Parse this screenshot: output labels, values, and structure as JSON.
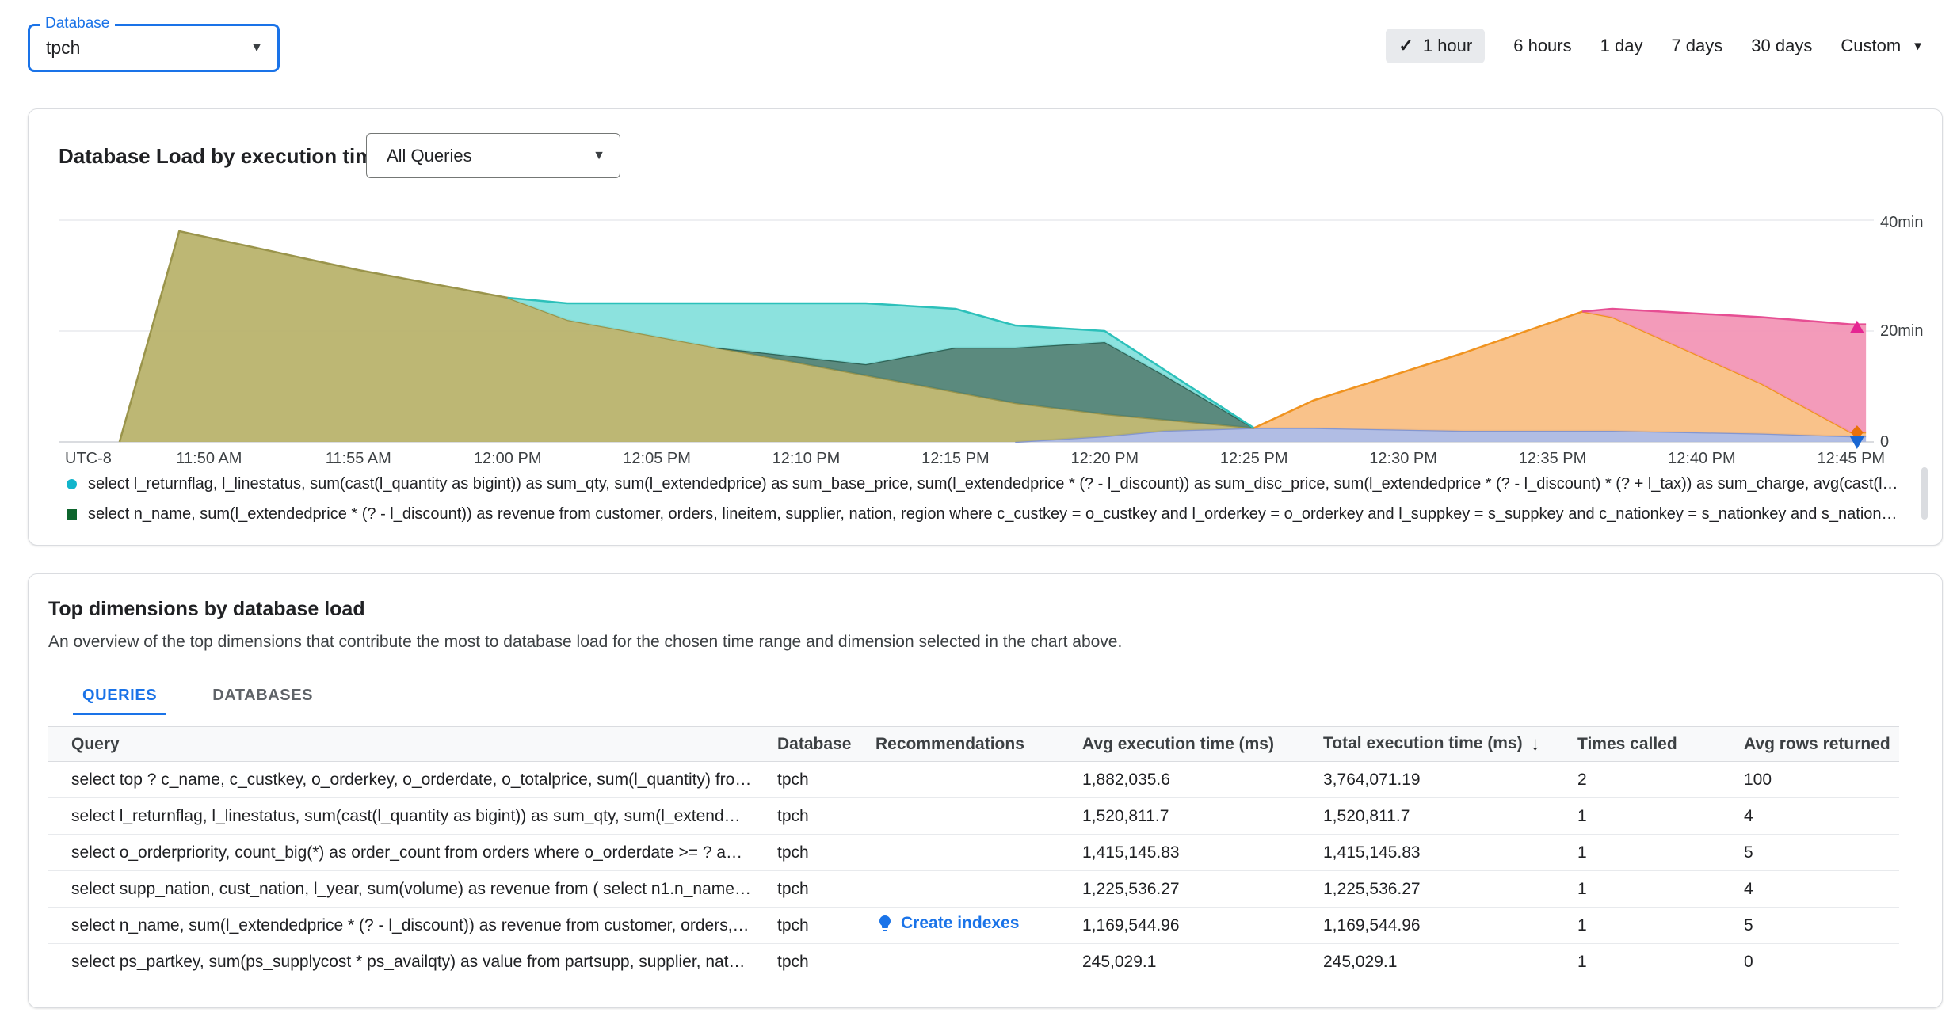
{
  "icons": {
    "check": "✓",
    "caret_down": "▼",
    "sort_desc": "↓"
  },
  "header": {
    "database_selector": {
      "label": "Database",
      "value": "tpch"
    },
    "time_range": {
      "options": [
        {
          "label": "1 hour",
          "selected": true,
          "has_caret": false
        },
        {
          "label": "6 hours",
          "selected": false,
          "has_caret": false
        },
        {
          "label": "1 day",
          "selected": false,
          "has_caret": false
        },
        {
          "label": "7 days",
          "selected": false,
          "has_caret": false
        },
        {
          "label": "30 days",
          "selected": false,
          "has_caret": false
        },
        {
          "label": "Custom",
          "selected": false,
          "has_caret": true
        }
      ]
    }
  },
  "load_card": {
    "title": "Database Load by execution time",
    "query_filter": {
      "value": "All Queries"
    },
    "chart_data": {
      "type": "area",
      "stacked": true,
      "title": "Database Load by execution time",
      "x_axis": {
        "prefix_label": "UTC-8",
        "ticks": [
          "11:50 AM",
          "11:55 AM",
          "12:00 PM",
          "12:05 PM",
          "12:10 PM",
          "12:15 PM",
          "12:20 PM",
          "12:25 PM",
          "12:30 PM",
          "12:35 PM",
          "12:40 PM",
          "12:45 PM"
        ],
        "tick_minutes": [
          5,
          10,
          15,
          20,
          25,
          30,
          35,
          40,
          45,
          50,
          55,
          60
        ]
      },
      "y_axis": {
        "unit": "min",
        "max": 40,
        "tick_labels": [
          "40min",
          "20min",
          "0"
        ],
        "tick_values": [
          40,
          20,
          0
        ]
      },
      "time_grid_minutes": [
        0,
        2,
        4,
        10,
        15,
        17,
        22,
        27,
        30,
        32,
        35,
        37,
        40,
        42,
        47,
        51,
        52,
        57,
        60,
        60.5
      ],
      "series": [
        {
          "id": "series-periwinkle",
          "fill": "#aab7e2",
          "stroke": "#8496cf",
          "values": [
            0,
            0,
            0,
            0,
            0,
            0,
            0,
            0,
            0,
            0,
            1,
            2,
            2.5,
            2.5,
            2,
            2,
            2,
            1.5,
            1,
            1
          ]
        },
        {
          "id": "series-olive",
          "fill": "#b7b168",
          "stroke": "#9a944b",
          "values": [
            0,
            0,
            38,
            31,
            26,
            22,
            17,
            12,
            9,
            7,
            4,
            2,
            0,
            0,
            0,
            0,
            0,
            0,
            0,
            0
          ]
        },
        {
          "id": "series-darkgreen",
          "fill": "#4d8073",
          "stroke": "#2f6457",
          "values": [
            0,
            0,
            0,
            0,
            0,
            0,
            0,
            2,
            8,
            10,
            13,
            8,
            0,
            0,
            0,
            0,
            0,
            0,
            0,
            0
          ]
        },
        {
          "id": "series-cyan",
          "fill": "#82dfdb",
          "stroke": "#2cc0ba",
          "values": [
            0,
            0,
            0,
            0,
            0,
            3,
            8,
            11,
            7,
            4,
            2,
            1,
            0,
            0,
            0,
            0,
            0,
            0,
            0,
            0
          ]
        },
        {
          "id": "series-orange",
          "fill": "#f9bd80",
          "stroke": "#f0931f",
          "values": [
            0,
            0,
            0,
            0,
            0,
            0,
            0,
            0,
            0,
            0,
            0,
            0,
            0,
            5,
            14,
            21.5,
            20.5,
            9,
            0.7,
            0.7
          ]
        },
        {
          "id": "series-pink",
          "fill": "#f292b4",
          "stroke": "#e64e93",
          "values": [
            0,
            0,
            0,
            0,
            0,
            0,
            0,
            0,
            0,
            0,
            0,
            0,
            0,
            0,
            0,
            0,
            1.5,
            12,
            19.5,
            19.5
          ]
        }
      ],
      "markers": [
        {
          "shape": "triangle-up",
          "color": "#e52592",
          "t": 60.2,
          "value": 20.6
        },
        {
          "shape": "diamond",
          "color": "#e8710a",
          "t": 60.2,
          "value": 1.7
        },
        {
          "shape": "triangle-down",
          "color": "#1967d2",
          "t": 60.2,
          "value": 0
        }
      ]
    },
    "legend": [
      {
        "marker": "circle",
        "color": "#12b5cb",
        "text": "select l_returnflag, l_linestatus, sum(cast(l_quantity as bigint)) as sum_qty, sum(l_extendedprice) as sum_base_price, sum(l_extendedprice * (? - l_discount)) as sum_disc_price, sum(l_extendedprice * (? - l_discount) * (? + l_tax)) as sum_charge, avg(cast(l_quantity as …"
      },
      {
        "marker": "square",
        "color": "#0d652d",
        "text": "select n_name, sum(l_extendedprice * (? - l_discount)) as revenue from customer, orders, lineitem, supplier, nation, region where c_custkey = o_custkey and l_orderkey = o_orderkey and l_suppkey = s_suppkey and c_nationkey = s_nationkey and s_nationkey = n_nation…"
      }
    ]
  },
  "dimensions_card": {
    "title": "Top dimensions by database load",
    "subtitle": "An overview of the top dimensions that contribute the most to database load for the chosen time range and dimension selected in the chart above.",
    "tabs": [
      {
        "label": "QUERIES",
        "active": true
      },
      {
        "label": "DATABASES",
        "active": false
      }
    ],
    "table": {
      "columns": [
        {
          "label": "Query"
        },
        {
          "label": "Database"
        },
        {
          "label": "Recommendations"
        },
        {
          "label": "Avg execution time (ms)"
        },
        {
          "label": "Total execution time (ms)",
          "sort": "desc"
        },
        {
          "label": "Times called"
        },
        {
          "label": "Avg rows returned"
        }
      ],
      "rows": [
        {
          "query": "select top ? c_name, c_custkey, o_orderkey, o_orderdate, o_totalprice, sum(l_quantity) fro…",
          "database": "tpch",
          "recommendation": "",
          "avg_execution_time_ms": "1,882,035.6",
          "total_execution_time_ms": "3,764,071.19",
          "times_called": "2",
          "avg_rows_returned": "100"
        },
        {
          "query": "select l_returnflag, l_linestatus, sum(cast(l_quantity as bigint)) as sum_qty, sum(l_extend…",
          "database": "tpch",
          "recommendation": "",
          "avg_execution_time_ms": "1,520,811.7",
          "total_execution_time_ms": "1,520,811.7",
          "times_called": "1",
          "avg_rows_returned": "4"
        },
        {
          "query": "select o_orderpriority, count_big(*) as order_count from orders where o_orderdate >= ? a…",
          "database": "tpch",
          "recommendation": "",
          "avg_execution_time_ms": "1,415,145.83",
          "total_execution_time_ms": "1,415,145.83",
          "times_called": "1",
          "avg_rows_returned": "5"
        },
        {
          "query": "select supp_nation, cust_nation, l_year, sum(volume) as revenue from ( select n1.n_name…",
          "database": "tpch",
          "recommendation": "",
          "avg_execution_time_ms": "1,225,536.27",
          "total_execution_time_ms": "1,225,536.27",
          "times_called": "1",
          "avg_rows_returned": "4"
        },
        {
          "query": "select n_name, sum(l_extendedprice * (? - l_discount)) as revenue from customer, orders,…",
          "database": "tpch",
          "recommendation": "Create indexes",
          "avg_execution_time_ms": "1,169,544.96",
          "total_execution_time_ms": "1,169,544.96",
          "times_called": "1",
          "avg_rows_returned": "5"
        },
        {
          "query": "select ps_partkey, sum(ps_supplycost * ps_availqty) as value from partsupp, supplier, nat…",
          "database": "tpch",
          "recommendation": "",
          "avg_execution_time_ms": "245,029.1",
          "total_execution_time_ms": "245,029.1",
          "times_called": "1",
          "avg_rows_returned": "0"
        }
      ]
    }
  }
}
